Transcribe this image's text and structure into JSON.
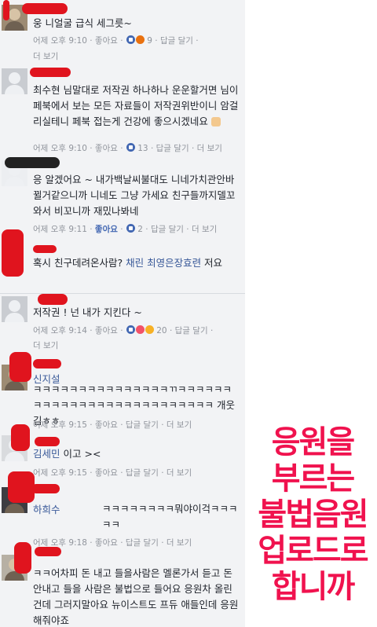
{
  "comments": [
    {
      "name": "",
      "text": "웅 니얼굴 급식 세그릇~",
      "meta": "어제 오후 9:10 · 좋아요 · ",
      "count": "9",
      "actions": " · 답글 달기 ·",
      "more": "더 보기"
    },
    {
      "name": "",
      "text": "최수현 님말대로 저작권 하나하나 운운할거면 님이 페북에서 보는 모든 자료들이 저작권위반이니 암걸리실테니 페북 접는게 건강에 좋으시겠네요",
      "meta": "어제 오후 9:10 · 좋아요 · ",
      "count": "13",
      "actions": " · 답글 달기 · 더 보기",
      "more": ""
    },
    {
      "name": "",
      "text": "응 알겠어요 ~ 내가백날씨불대도 니네가치관안바뀔거같으니까 니네도 그냥 가세요 친구들까지델꼬와서 비꼬니까 재밌나봐네",
      "meta_time": "어제 오후 9:11 · ",
      "meta_like": "좋아요",
      "meta_sep": " · ",
      "count": "2",
      "actions": " · 답글 달기 · 더 보기"
    },
    {
      "name": "",
      "text_prefix": "혹시 친구데려온사람? ",
      "tags": "채린 최영은장효련",
      "text_suffix": " 저요",
      "meta": ""
    },
    {
      "name": "",
      "text": "저작권 ! 넌 내가 지킨다 ~",
      "meta": "어제 오후 9:14 · 좋아요 · ",
      "count": "20",
      "actions": " · 답글 달기 ·",
      "more": "더 보기"
    },
    {
      "name": "신지설",
      "text": "ㅋㅋㅋㅋㅋㅋㅋㅋㅋㅋㅋㅋㅋㅋㅋㄲㅋㅋㅋㅋㅋㅋㅋㅋㅋㅋㅋㅋㅋㅋㅋㅋㅋㅋㅋㅋㅋㅋㅋㅋㅋㅋ 개웃김ㅎㅎ",
      "meta": "어제 오후 9:15 · 좋아요 · 답글 달기 · 더 보기"
    },
    {
      "name": "김세민",
      "text": "이고 ><",
      "meta": "어제 오후 9:15 · 좋아요 · 답글 달기 · 더 보기"
    },
    {
      "name": "하희수",
      "text": "ㅋㅋㅋㅋㅋㅋㅋㅋ뭐야이걱ㅋㅋㅋㅋㅋ",
      "meta": "어제 오후 9:18 · 좋아요 · 답글 달기 · 더 보기"
    },
    {
      "name": "",
      "text": "ㅋㅋ어차피 돈 내고 들을사람은 멜론가서 듣고 돈 안내고 들을 사람은 불법으로 들어요 응원차 올린건데 그러지말아요 뉴이스트도 프듀 애들인데 응원해줘야죠",
      "meta": ""
    }
  ],
  "sticker": {
    "lines": [
      "응원을",
      "부르는",
      "불법음원",
      "업로드로",
      "합니까"
    ],
    "color": "#f0124e"
  },
  "colors": {
    "panel": "#f2f3f5",
    "link": "#385898",
    "muted": "#90949c",
    "like": "#4267b2",
    "redaction": "#e0141e"
  }
}
